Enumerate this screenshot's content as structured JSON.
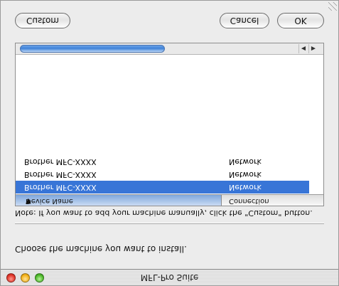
{
  "window": {
    "title": "MFL-Pro Suite"
  },
  "instructions": {
    "choose": "Choose the machine you want to install.",
    "note": "Note: If you want to add your machine manually, click the \"Custom\" button."
  },
  "table": {
    "columns": [
      "Device Name",
      "Connection"
    ],
    "rows": [
      {
        "device": "Brother MFC-XXXX",
        "connection": "Network",
        "selected": true
      },
      {
        "device": "Brother MFC-XXXX",
        "connection": "Network",
        "selected": false
      },
      {
        "device": "Brother MFC-XXXX",
        "connection": "Network",
        "selected": false
      }
    ],
    "sort_icon": "triangle-down-icon"
  },
  "buttons": {
    "custom": "Custom",
    "cancel": "Cancel",
    "ok": "OK"
  },
  "icons": {
    "close": "close-icon",
    "minimize": "minimize-icon",
    "zoom": "zoom-icon",
    "scroll_left": "arrow-left-icon",
    "scroll_right": "arrow-right-icon"
  },
  "colors": {
    "selection": "#3875d7",
    "window_bg": "#ececec"
  }
}
